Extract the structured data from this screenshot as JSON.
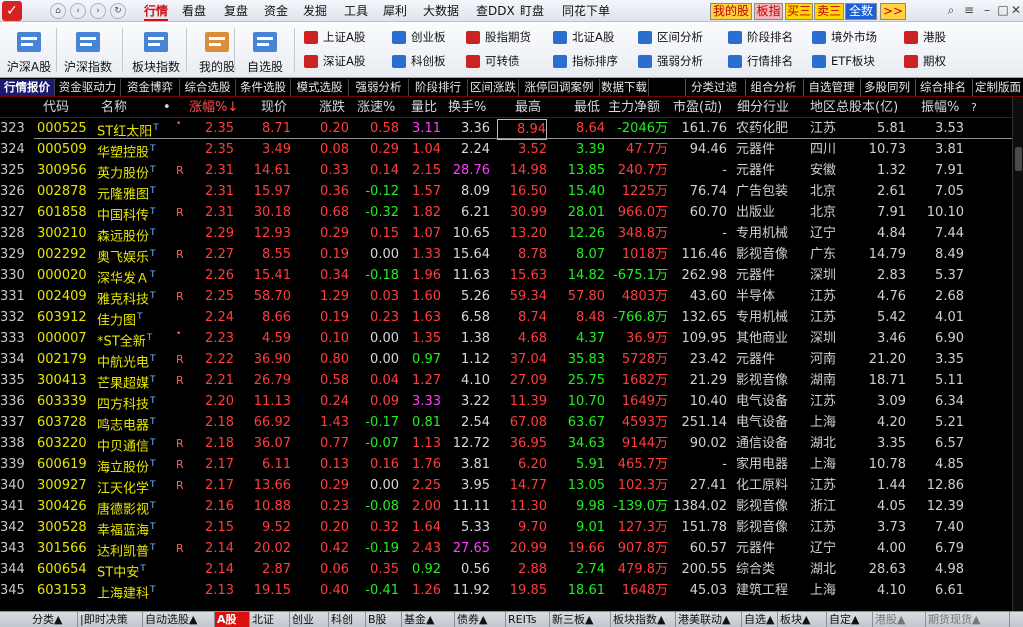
{
  "menu": {
    "items": [
      "行情",
      "看盘",
      "复盘",
      "资金",
      "发掘",
      "工具",
      "犀利",
      "大数据",
      "查DDX",
      "盯盘",
      "同花下单"
    ],
    "active": "行情",
    "quick_buttons": [
      "我的股",
      "板指",
      "买三",
      "卖三",
      "全数",
      ">>"
    ]
  },
  "toolbar": {
    "big": [
      "沪深A股",
      "沪深指数",
      "板块指数",
      "我的股",
      "自选股"
    ],
    "small": [
      [
        "上证A股",
        "深证A股"
      ],
      [
        "创业板",
        "科创板"
      ],
      [
        "股指期货",
        "可转债"
      ],
      [
        "北证A股",
        "指标排序"
      ],
      [
        "区间分析",
        "强弱分析"
      ],
      [
        "阶段排名",
        "行情排名"
      ],
      [
        "境外市场",
        "ETF板块"
      ],
      [
        "港股",
        "期权"
      ]
    ]
  },
  "function_tabs": [
    "行情报价",
    "资金驱动力",
    "资金博弈",
    "综合选股",
    "条件选股",
    "模式选股",
    "强弱分析",
    "阶段排行",
    "区间涨跌",
    "涨停回调案例",
    "数据下载"
  ],
  "function_tabs_right": [
    "分类过滤",
    "组合分析",
    "自选管理",
    "多股同列",
    "综合排名",
    "定制版面"
  ],
  "active_function_tab": "行情报价",
  "table": {
    "headers": {
      "code": "代码",
      "name": "名称",
      "dot": "•",
      "chg": "涨幅%",
      "price": "现价",
      "diff": "涨跌",
      "speed": "涨速%",
      "vr": "量比",
      "turn": "换手%",
      "high": "最高",
      "low": "最低",
      "net": "主力净额",
      "pe": "市盈(动)",
      "ind": "细分行业",
      "reg": "地区",
      "cap": "总股本(亿)",
      "amp": "振幅%",
      "q": "?"
    },
    "sort_arrow": "↓",
    "rows": [
      {
        "no": "323",
        "code": "000525",
        "name": "ST红太阳",
        "sup": "T",
        "mark": "•",
        "chg": "2.35",
        "price": "8.71",
        "diff": "0.20",
        "speed": "0.58",
        "vr": "3.11",
        "turn": "3.36",
        "high": "8.94",
        "low": "8.64",
        "net": "-2046万",
        "pe": "161.76",
        "ind": "农药化肥",
        "reg": "江苏",
        "cap": "5.81",
        "amp": "3.53",
        "highBox": true
      },
      {
        "no": "324",
        "code": "000509",
        "name": "华塑控股",
        "sup": "T",
        "mark": "",
        "chg": "2.35",
        "price": "3.49",
        "diff": "0.08",
        "speed": "0.29",
        "vr": "1.04",
        "turn": "2.24",
        "high": "3.52",
        "low": "3.39",
        "net": "47.7万",
        "pe": "94.46",
        "ind": "元器件",
        "reg": "四川",
        "cap": "10.73",
        "amp": "3.81"
      },
      {
        "no": "325",
        "code": "300956",
        "name": "英力股份",
        "sup": "T",
        "mark": "R",
        "chg": "2.31",
        "price": "14.61",
        "diff": "0.33",
        "speed": "0.14",
        "vr": "2.15",
        "turn": "28.76",
        "high": "14.98",
        "low": "13.85",
        "net": "240.7万",
        "pe": "-",
        "ind": "元器件",
        "reg": "安徽",
        "cap": "1.32",
        "amp": "7.91"
      },
      {
        "no": "326",
        "code": "002878",
        "name": "元隆雅图",
        "sup": "T",
        "mark": "",
        "chg": "2.31",
        "price": "15.97",
        "diff": "0.36",
        "speed": "-0.12",
        "vr": "1.57",
        "turn": "8.09",
        "high": "16.50",
        "low": "15.40",
        "net": "1225万",
        "pe": "76.74",
        "ind": "广告包装",
        "reg": "北京",
        "cap": "2.61",
        "amp": "7.05"
      },
      {
        "no": "327",
        "code": "601858",
        "name": "中国科传",
        "sup": "T",
        "mark": "R",
        "chg": "2.31",
        "price": "30.18",
        "diff": "0.68",
        "speed": "-0.32",
        "vr": "1.82",
        "turn": "6.21",
        "high": "30.99",
        "low": "28.01",
        "net": "966.0万",
        "pe": "60.70",
        "ind": "出版业",
        "reg": "北京",
        "cap": "7.91",
        "amp": "10.10"
      },
      {
        "no": "328",
        "code": "300210",
        "name": "森远股份",
        "sup": "T",
        "mark": "",
        "chg": "2.29",
        "price": "12.93",
        "diff": "0.29",
        "speed": "0.15",
        "vr": "1.07",
        "turn": "10.65",
        "high": "13.20",
        "low": "12.26",
        "net": "348.8万",
        "pe": "-",
        "ind": "专用机械",
        "reg": "辽宁",
        "cap": "4.84",
        "amp": "7.44"
      },
      {
        "no": "329",
        "code": "002292",
        "name": "奥飞娱乐",
        "sup": "T",
        "mark": "R",
        "chg": "2.27",
        "price": "8.55",
        "diff": "0.19",
        "speed": "0.00",
        "vr": "1.33",
        "turn": "15.64",
        "high": "8.78",
        "low": "8.07",
        "net": "1018万",
        "pe": "116.46",
        "ind": "影视音像",
        "reg": "广东",
        "cap": "14.79",
        "amp": "8.49"
      },
      {
        "no": "330",
        "code": "000020",
        "name": "深华发Ａ",
        "sup": "T",
        "mark": "",
        "chg": "2.26",
        "price": "15.41",
        "diff": "0.34",
        "speed": "-0.18",
        "vr": "1.96",
        "turn": "11.63",
        "high": "15.63",
        "low": "14.82",
        "net": "-675.1万",
        "pe": "262.98",
        "ind": "元器件",
        "reg": "深圳",
        "cap": "2.83",
        "amp": "5.37"
      },
      {
        "no": "331",
        "code": "002409",
        "name": "雅克科技",
        "sup": "T",
        "mark": "R",
        "chg": "2.25",
        "price": "58.70",
        "diff": "1.29",
        "speed": "0.03",
        "vr": "1.60",
        "turn": "5.26",
        "high": "59.34",
        "low": "57.80",
        "net": "4803万",
        "pe": "43.60",
        "ind": "半导体",
        "reg": "江苏",
        "cap": "4.76",
        "amp": "2.68"
      },
      {
        "no": "332",
        "code": "603912",
        "name": "佳力图",
        "sup": "T",
        "mark": "",
        "chg": "2.24",
        "price": "8.66",
        "diff": "0.19",
        "speed": "0.23",
        "vr": "1.63",
        "turn": "6.58",
        "high": "8.74",
        "low": "8.48",
        "net": "-766.8万",
        "pe": "132.65",
        "ind": "专用机械",
        "reg": "江苏",
        "cap": "5.42",
        "amp": "4.01"
      },
      {
        "no": "333",
        "code": "000007",
        "name": "*ST全新",
        "sup": "T",
        "mark": "•",
        "chg": "2.23",
        "price": "4.59",
        "diff": "0.10",
        "speed": "0.00",
        "vr": "1.35",
        "turn": "1.38",
        "high": "4.68",
        "low": "4.37",
        "net": "36.9万",
        "pe": "109.95",
        "ind": "其他商业",
        "reg": "深圳",
        "cap": "3.46",
        "amp": "6.90"
      },
      {
        "no": "334",
        "code": "002179",
        "name": "中航光电",
        "sup": "T",
        "mark": "R",
        "chg": "2.22",
        "price": "36.90",
        "diff": "0.80",
        "speed": "0.00",
        "vr": "0.97",
        "turn": "1.12",
        "high": "37.04",
        "low": "35.83",
        "net": "5728万",
        "pe": "23.42",
        "ind": "元器件",
        "reg": "河南",
        "cap": "21.20",
        "amp": "3.35"
      },
      {
        "no": "335",
        "code": "300413",
        "name": "芒果超媒",
        "sup": "T",
        "mark": "R",
        "chg": "2.21",
        "price": "26.79",
        "diff": "0.58",
        "speed": "0.04",
        "vr": "1.27",
        "turn": "4.10",
        "high": "27.09",
        "low": "25.75",
        "net": "1682万",
        "pe": "21.29",
        "ind": "影视音像",
        "reg": "湖南",
        "cap": "18.71",
        "amp": "5.11"
      },
      {
        "no": "336",
        "code": "603339",
        "name": "四方科技",
        "sup": "T",
        "mark": "",
        "chg": "2.20",
        "price": "11.13",
        "diff": "0.24",
        "speed": "0.09",
        "vr": "3.33",
        "turn": "3.22",
        "high": "11.39",
        "low": "10.70",
        "net": "1649万",
        "pe": "10.40",
        "ind": "电气设备",
        "reg": "江苏",
        "cap": "3.09",
        "amp": "6.34"
      },
      {
        "no": "337",
        "code": "603728",
        "name": "鸣志电器",
        "sup": "T",
        "mark": "",
        "chg": "2.18",
        "price": "66.92",
        "diff": "1.43",
        "speed": "-0.17",
        "vr": "0.81",
        "turn": "2.54",
        "high": "67.08",
        "low": "63.67",
        "net": "4593万",
        "pe": "251.14",
        "ind": "电气设备",
        "reg": "上海",
        "cap": "4.20",
        "amp": "5.21"
      },
      {
        "no": "338",
        "code": "603220",
        "name": "中贝通信",
        "sup": "T",
        "mark": "R",
        "chg": "2.18",
        "price": "36.07",
        "diff": "0.77",
        "speed": "-0.07",
        "vr": "1.13",
        "turn": "12.72",
        "high": "36.95",
        "low": "34.63",
        "net": "9144万",
        "pe": "90.02",
        "ind": "通信设备",
        "reg": "湖北",
        "cap": "3.35",
        "amp": "6.57"
      },
      {
        "no": "339",
        "code": "600619",
        "name": "海立股份",
        "sup": "T",
        "mark": "R",
        "chg": "2.17",
        "price": "6.11",
        "diff": "0.13",
        "speed": "0.16",
        "vr": "1.76",
        "turn": "3.81",
        "high": "6.20",
        "low": "5.91",
        "net": "465.7万",
        "pe": "-",
        "ind": "家用电器",
        "reg": "上海",
        "cap": "10.78",
        "amp": "4.85"
      },
      {
        "no": "340",
        "code": "300927",
        "name": "江天化学",
        "sup": "T",
        "mark": "R",
        "chg": "2.17",
        "price": "13.66",
        "diff": "0.29",
        "speed": "0.00",
        "vr": "2.25",
        "turn": "3.95",
        "high": "14.77",
        "low": "13.05",
        "net": "102.3万",
        "pe": "27.41",
        "ind": "化工原料",
        "reg": "江苏",
        "cap": "1.44",
        "amp": "12.86"
      },
      {
        "no": "341",
        "code": "300426",
        "name": "唐德影视",
        "sup": "T",
        "mark": "",
        "chg": "2.16",
        "price": "10.88",
        "diff": "0.23",
        "speed": "-0.08",
        "vr": "2.00",
        "turn": "11.11",
        "high": "11.30",
        "low": "9.98",
        "net": "-139.0万",
        "pe": "1384.02",
        "ind": "影视音像",
        "reg": "浙江",
        "cap": "4.05",
        "amp": "12.39"
      },
      {
        "no": "342",
        "code": "300528",
        "name": "幸福蓝海",
        "sup": "T",
        "mark": "",
        "chg": "2.15",
        "price": "9.52",
        "diff": "0.20",
        "speed": "0.32",
        "vr": "1.64",
        "turn": "5.33",
        "high": "9.70",
        "low": "9.01",
        "net": "127.3万",
        "pe": "151.78",
        "ind": "影视音像",
        "reg": "江苏",
        "cap": "3.73",
        "amp": "7.40"
      },
      {
        "no": "343",
        "code": "301566",
        "name": "达利凯普",
        "sup": "T",
        "mark": "R",
        "chg": "2.14",
        "price": "20.02",
        "diff": "0.42",
        "speed": "-0.19",
        "vr": "2.43",
        "turn": "27.65",
        "high": "20.99",
        "low": "19.66",
        "net": "907.8万",
        "pe": "60.57",
        "ind": "元器件",
        "reg": "辽宁",
        "cap": "4.00",
        "amp": "6.79"
      },
      {
        "no": "344",
        "code": "600654",
        "name": "ST中安",
        "sup": "T",
        "mark": "",
        "chg": "2.14",
        "price": "2.87",
        "diff": "0.06",
        "speed": "0.35",
        "vr": "0.92",
        "turn": "0.56",
        "high": "2.88",
        "low": "2.74",
        "net": "479.8万",
        "pe": "200.55",
        "ind": "综合类",
        "reg": "湖北",
        "cap": "28.63",
        "amp": "4.98"
      },
      {
        "no": "345",
        "code": "603153",
        "name": "上海建科",
        "sup": "T",
        "mark": "",
        "chg": "2.13",
        "price": "19.15",
        "diff": "0.40",
        "speed": "-0.41",
        "vr": "1.26",
        "turn": "11.92",
        "high": "19.85",
        "low": "18.61",
        "net": "1648万",
        "pe": "45.03",
        "ind": "建筑工程",
        "reg": "上海",
        "cap": "4.10",
        "amp": "6.61"
      }
    ]
  },
  "bottom_tabs": [
    "分类▲",
    "|即时决策",
    "自动选股▲",
    "A股",
    "北证",
    "创业",
    "科创",
    "B股",
    "基金▲",
    "债券▲",
    "REITs",
    "新三板▲",
    "板块指数▲",
    "港美联动▲",
    "自选▲",
    "板块▲",
    "自定▲",
    "港股▲",
    "期货现货▲"
  ],
  "active_bottom_tab": "A股"
}
